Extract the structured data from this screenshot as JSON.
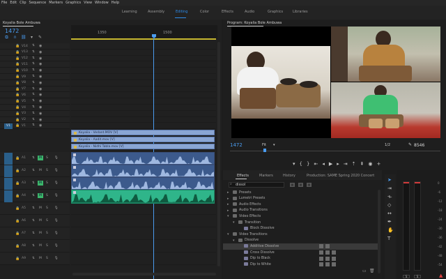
{
  "menu": [
    "File",
    "Edit",
    "Clip",
    "Sequence",
    "Markers",
    "Graphics",
    "View",
    "Window",
    "Help"
  ],
  "workspaces": [
    {
      "label": "Learning",
      "active": false
    },
    {
      "label": "Assembly",
      "active": false
    },
    {
      "label": "Editing",
      "active": true
    },
    {
      "label": "Color",
      "active": false
    },
    {
      "label": "Effects",
      "active": false
    },
    {
      "label": "Audio",
      "active": false
    },
    {
      "label": "Graphics",
      "active": false
    },
    {
      "label": "Libraries",
      "active": false
    }
  ],
  "timeline": {
    "tab": "Koyalia Bole Ambuwa",
    "timecode": "1472",
    "ruler_ticks": [
      "1350",
      "1500"
    ],
    "video_tracks": [
      "V14",
      "V13",
      "V12",
      "V11",
      "V10",
      "V9",
      "V8",
      "V7",
      "V6",
      "V5",
      "V4",
      "V3",
      "V2",
      "V1"
    ],
    "source_patch": "V1",
    "video_clips": [
      {
        "label": "Koyalia - Vedant.MOV [V]"
      },
      {
        "label": "Koyalia - Aadit.mov [V]"
      },
      {
        "label": "Koyalia - Nidhi Tabla.mov [V]"
      }
    ],
    "audio_tracks": [
      "A1",
      "A2",
      "A3",
      "A4",
      "A5",
      "A6",
      "A7",
      "A8",
      "A9"
    ],
    "audio_track_buttons": {
      "mute": "M",
      "solo": "S"
    }
  },
  "program": {
    "tab": "Program: Koyalia Bole Ambuwa",
    "timecode": "1472",
    "fit": "Fit",
    "ratio": "1/2",
    "duration": "8546"
  },
  "effects": {
    "tabs": [
      {
        "label": "Effects",
        "active": true
      },
      {
        "label": "Markers",
        "active": false
      },
      {
        "label": "History",
        "active": false
      },
      {
        "label": "Production: SAME Spring 2020 Concert",
        "active": false
      }
    ],
    "search_value": "dissol",
    "items": [
      {
        "label": "Presets",
        "level": 0,
        "type": "folder",
        "open": false,
        "badges": 0,
        "selected": false
      },
      {
        "label": "Lumetri Presets",
        "level": 0,
        "type": "folder",
        "open": false,
        "badges": 0,
        "selected": false
      },
      {
        "label": "Audio Effects",
        "level": 0,
        "type": "folder",
        "open": false,
        "badges": 0,
        "selected": false
      },
      {
        "label": "Audio Transitions",
        "level": 0,
        "type": "folder",
        "open": false,
        "badges": 0,
        "selected": false
      },
      {
        "label": "Video Effects",
        "level": 0,
        "type": "folder",
        "open": true,
        "badges": 0,
        "selected": false
      },
      {
        "label": "Transition",
        "level": 1,
        "type": "folder",
        "open": true,
        "badges": 0,
        "selected": false
      },
      {
        "label": "Block Dissolve",
        "level": 2,
        "type": "effect",
        "open": false,
        "badges": 0,
        "selected": false
      },
      {
        "label": "Video Transitions",
        "level": 0,
        "type": "folder",
        "open": true,
        "badges": 0,
        "selected": false
      },
      {
        "label": "Dissolve",
        "level": 1,
        "type": "folder",
        "open": true,
        "badges": 0,
        "selected": false
      },
      {
        "label": "Additive Dissolve",
        "level": 2,
        "type": "effect",
        "open": false,
        "badges": 2,
        "selected": true
      },
      {
        "label": "Cross Dissolve",
        "level": 2,
        "type": "effect",
        "open": false,
        "badges": 3,
        "selected": false
      },
      {
        "label": "Dip to Black",
        "level": 2,
        "type": "effect",
        "open": false,
        "badges": 3,
        "selected": false
      },
      {
        "label": "Dip to White",
        "level": 2,
        "type": "effect",
        "open": false,
        "badges": 3,
        "selected": false
      }
    ]
  },
  "meters": {
    "db_labels": [
      "0",
      "-6",
      "-12",
      "-18",
      "-24",
      "-30",
      "-36",
      "-42",
      "-48",
      "-54"
    ],
    "channel_labels": [
      "S",
      "S"
    ]
  },
  "colors": {
    "accent": "#2d8ceb",
    "video_clip": "#8aa6d4",
    "audio_clip_blue": "#3c5a8c",
    "audio_clip_green": "#2fb58a",
    "solo_active": "#3bb56a",
    "peak": "#d13a3a"
  }
}
